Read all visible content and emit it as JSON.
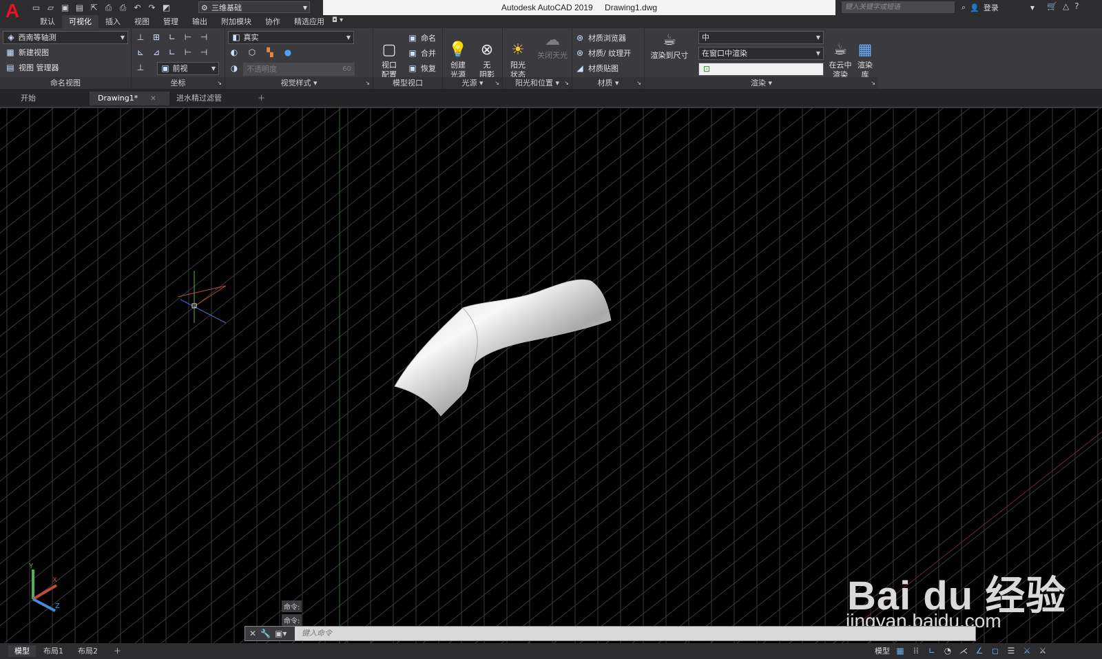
{
  "app": {
    "product": "Autodesk AutoCAD 2019",
    "document": "Drawing1.dwg",
    "workspace": "三维基础",
    "search_placeholder": "键入关键字或短语",
    "signin": "登录"
  },
  "menu_tabs": [
    "默认",
    "可视化",
    "插入",
    "视图",
    "管理",
    "输出",
    "附加模块",
    "协作",
    "精选应用"
  ],
  "ribbon": {
    "named_views": {
      "title": "命名视图",
      "view_combo": "西南等轴测",
      "new_view": "新建视图",
      "view_manager": "视图 管理器"
    },
    "coordinates": {
      "title": "坐标",
      "ucs_combo": "前视"
    },
    "visual_styles": {
      "title": "视觉样式",
      "style_combo": "真实",
      "opacity_label": "不透明度",
      "opacity_value": "60"
    },
    "model_viewports": {
      "title": "模型视口",
      "viewport_config": "视口\n配置",
      "named": "命名",
      "join": "合并",
      "restore": "恢复"
    },
    "lights": {
      "title": "光源",
      "create_light": "创建\n光源",
      "no_shadow": "无\n阴影"
    },
    "sun_location": {
      "title": "阳光和位置",
      "sun_status": "阳光\n状态",
      "sky_off": "关闭天光"
    },
    "materials": {
      "title": "材质",
      "browser": "材质浏览器",
      "texture": "材质/ 纹理开",
      "mapping": "材质贴图"
    },
    "render": {
      "title": "渲染",
      "render_to_size": "渲染到尺寸",
      "quality_combo": "中",
      "render_in_combo": "在窗口中渲染",
      "render_in_cloud": "在云中\n渲染",
      "render_gallery": "渲染\n库"
    }
  },
  "doc_tabs": [
    {
      "label": "开始",
      "active": false
    },
    {
      "label": "Drawing1*",
      "active": true
    },
    {
      "label": "进水精过滤管",
      "active": false
    }
  ],
  "command": {
    "history": [
      "命令:",
      "命令:"
    ],
    "placeholder": "键入命令"
  },
  "layout_tabs": [
    "模型",
    "布局1",
    "布局2"
  ],
  "status": {
    "model_label": "模型"
  },
  "ucs_icon": {
    "x": "X",
    "y": "Y",
    "z": "Z"
  },
  "watermark": {
    "logo": "Bai du 经验",
    "url": "jingyan.baidu.com"
  },
  "colors": {
    "accent_red": "#e8131b",
    "ribbon_bg": "#3b3b3f",
    "titlebar_bg": "#2d2d30",
    "status_blue": "#6aaeea"
  }
}
